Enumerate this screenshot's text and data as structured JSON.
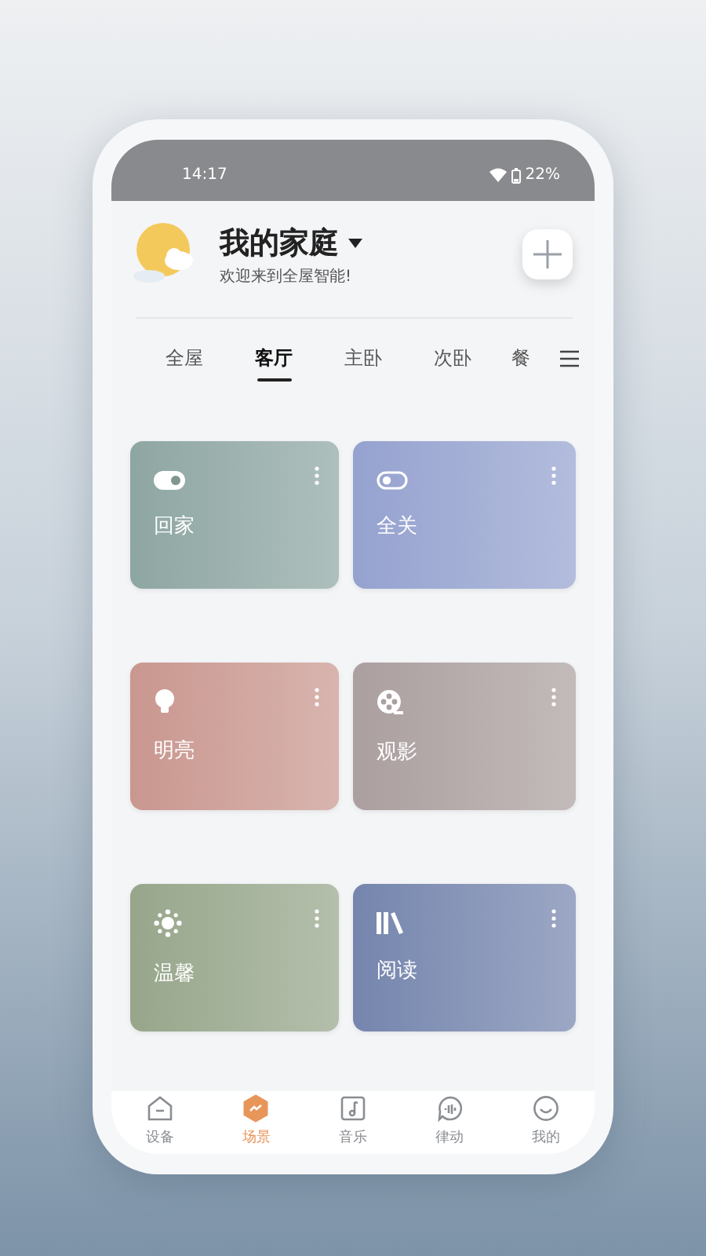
{
  "status_bar": {
    "time": "14:17",
    "battery": "22%"
  },
  "header": {
    "title": "我的家庭",
    "subtitle": "欢迎来到全屋智能!"
  },
  "tabs": [
    {
      "label": "全屋",
      "selected": false
    },
    {
      "label": "客厅",
      "selected": true
    },
    {
      "label": "主卧",
      "selected": false
    },
    {
      "label": "次卧",
      "selected": false
    },
    {
      "label": "餐",
      "selected": false
    }
  ],
  "scenes": [
    {
      "name": "回家",
      "color": "#8ea6a2"
    },
    {
      "name": "全关",
      "color": "#95a2cf"
    },
    {
      "name": "明亮",
      "color": "#c9978f"
    },
    {
      "name": "观影",
      "color": "#ab9f9f"
    },
    {
      "name": "温馨",
      "color": "#97a68b"
    },
    {
      "name": "阅读",
      "color": "#7585ad"
    }
  ],
  "nav": [
    {
      "label": "设备",
      "selected": false
    },
    {
      "label": "场景",
      "selected": true
    },
    {
      "label": "音乐",
      "selected": false
    },
    {
      "label": "律动",
      "selected": false
    },
    {
      "label": "我的",
      "selected": false
    }
  ]
}
